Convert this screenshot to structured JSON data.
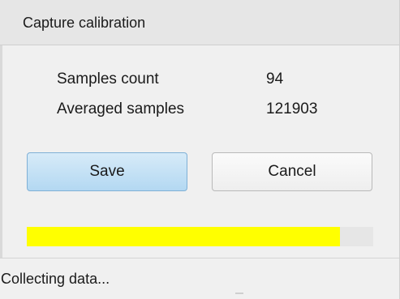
{
  "window": {
    "title": "Capture calibration"
  },
  "info": {
    "samples_count_label": "Samples count",
    "samples_count_value": "94",
    "averaged_samples_label": "Averaged samples",
    "averaged_samples_value": "121903"
  },
  "buttons": {
    "save_label": "Save",
    "cancel_label": "Cancel"
  },
  "progress": {
    "fraction": 0.905,
    "fill_color": "#ffff00",
    "track_color": "#e6e6e6"
  },
  "status": {
    "text": "Collecting data..."
  }
}
